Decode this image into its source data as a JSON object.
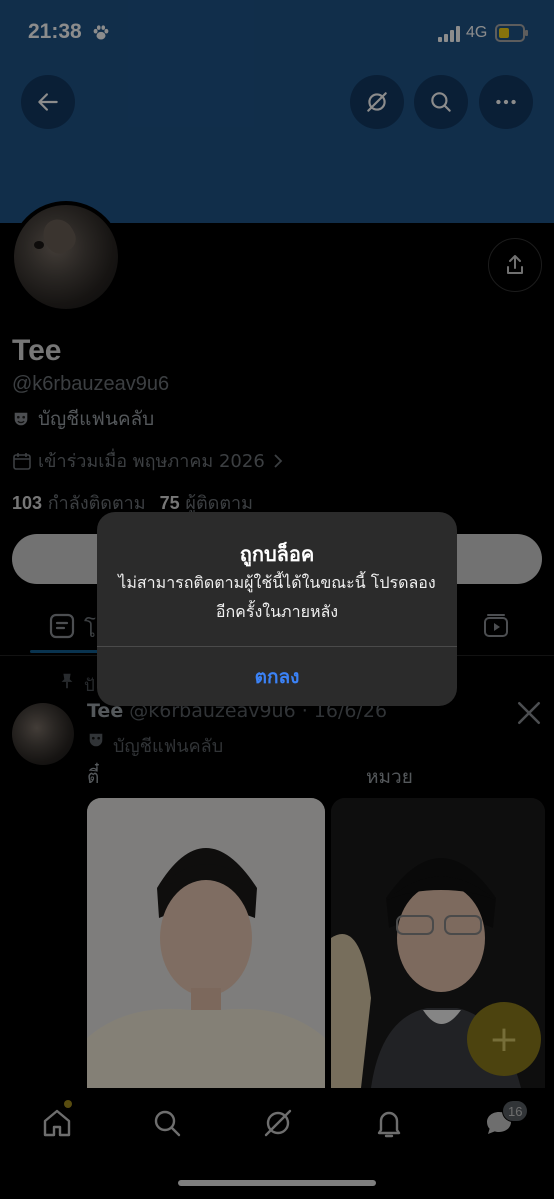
{
  "status_bar": {
    "time": "21:38",
    "network": "4G"
  },
  "header": {
    "back_icon": "arrow-left-icon",
    "grok_icon": "grok-icon",
    "search_icon": "search-icon",
    "more_icon": "more-dots-icon",
    "banner_color": "#1f5488"
  },
  "profile": {
    "name": "Tee",
    "handle": "@k6rbauzeav9u6",
    "fanclub_label": "บัญชีแฟนคลับ",
    "joined": "เข้าร่วมเมื่อ พฤษภาคม 2026",
    "following_count": "103",
    "following_label": "กำลังติดตาม",
    "followers_count": "75",
    "followers_label": "ผู้ติดตาม"
  },
  "tabs": {
    "posts_partial": "โ"
  },
  "pinned": {
    "label_partial": "ปั"
  },
  "post": {
    "author": "Tee",
    "meta": "@k6rbauzeav9u6 · 16/6/26",
    "fanclub_label": "บัญชีแฟนคลับ",
    "text_left": "ตี๋",
    "text_right": "หมวย"
  },
  "bottom_nav": {
    "notification_badge": "16",
    "accent_color": "#a08a1c"
  },
  "alert": {
    "title": "ถูกบล็อค",
    "message": "ไม่สามารถติดตามผู้ใช้นี้ได้ในขณะนี้ โปรดลองอีกครั้งในภายหลัง",
    "ok_label": "ตกลง",
    "ok_color": "#3b82f6"
  }
}
